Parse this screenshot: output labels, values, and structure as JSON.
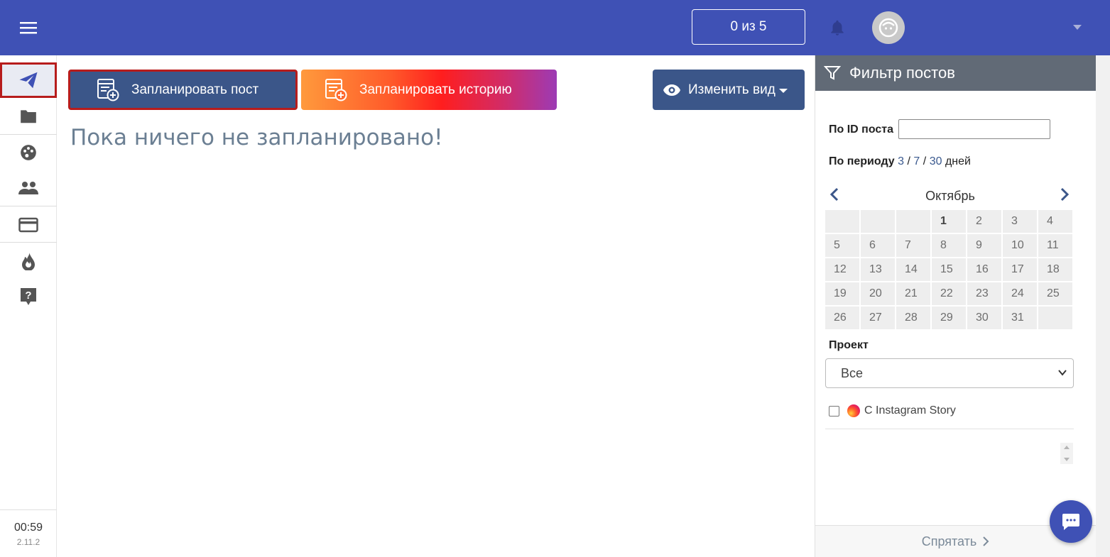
{
  "header": {
    "counter": "0 из 5"
  },
  "sidebar": {
    "items": [
      {
        "icon": "paper-plane-icon",
        "active": true
      },
      {
        "icon": "folder-icon"
      },
      {
        "icon": "palette-icon"
      },
      {
        "icon": "people-icon"
      },
      {
        "icon": "credit-card-icon"
      },
      {
        "icon": "fire-icon"
      },
      {
        "icon": "help-icon"
      }
    ],
    "time": "00:59",
    "version": "2.11.2"
  },
  "toolbar": {
    "schedule_post": "Запланировать пост",
    "schedule_story": "Запланировать историю",
    "change_view": "Изменить вид"
  },
  "main": {
    "empty_message": "Пока ничего не запланировано!"
  },
  "filter": {
    "title": "Фильтр постов",
    "by_id_label": "По ID поста",
    "by_id_value": "",
    "by_period_label": "По периоду",
    "period_options": [
      "3",
      "7",
      "30"
    ],
    "period_sep": "/",
    "period_suffix": "дней",
    "month": "Октябрь",
    "calendar_weeks": [
      [
        "",
        "",
        "",
        "1",
        "2",
        "3",
        "4"
      ],
      [
        "5",
        "6",
        "7",
        "8",
        "9",
        "10",
        "11"
      ],
      [
        "12",
        "13",
        "14",
        "15",
        "16",
        "17",
        "18"
      ],
      [
        "19",
        "20",
        "21",
        "22",
        "23",
        "24",
        "25"
      ],
      [
        "26",
        "27",
        "28",
        "29",
        "30",
        "31",
        ""
      ]
    ],
    "project_label": "Проект",
    "project_value": "Все",
    "instagram_story_label": "С Instagram Story",
    "hide_label": "Спрятать"
  },
  "colors": {
    "primary": "#3f51b5",
    "button_dark": "#3b5689",
    "active_border": "#b71c1c"
  }
}
